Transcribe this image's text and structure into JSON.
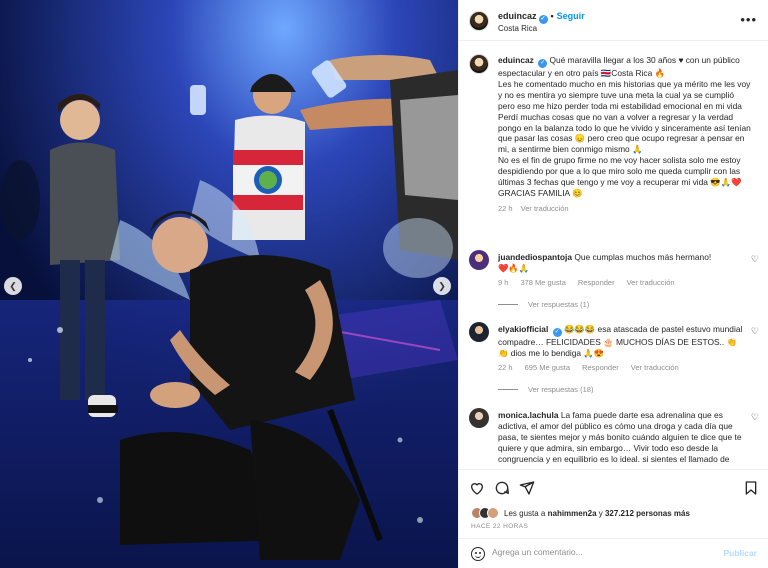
{
  "post": {
    "username": "eduincaz",
    "follow_label": "Seguir",
    "location": "Costa Rica",
    "more_label": "•••"
  },
  "caption": {
    "username": "eduincaz",
    "text": "Qué maravilla llegar a los 30 años ♥ con un público espectacular y en otro país 🇨🇷Costa Rica 🔥\nLes he comentado mucho en mis historias que ya mérito me les voy y no es mentira yo siempre tuve una meta la cual ya se cumplió pero eso me hizo perder toda mi estabilidad emocional en mi vida\nPerdí muchas cosas que no van a volver a regresar y la verdad pongo en la balanza todo lo que he vivido y sinceramente así tenían que pasar las cosas 😞 pero creo que ocupo regresar a pensar en mi, a sentirme bien conmigo mismo 🙏\nNo es el fin de grupo firme no me voy hacer solista solo me estoy despidiendo por que a lo que miro solo me queda cumplir con las últimas 3 fechas que tengo y me voy a recuperar mi vida 😎🙏❤️\nGRACIAS FAMILIA 😊",
    "time": "22 h",
    "translate": "Ver traducción"
  },
  "comments": [
    {
      "username": "juandediospantoja",
      "text": "Que cumplas muchos más hermano!\n❤️🔥🙏",
      "time": "9 h",
      "likes": "378 Me gusta",
      "reply": "Responder",
      "translate": "Ver traducción",
      "replies": "Ver respuestas (1)"
    },
    {
      "username": "elyakiofficial",
      "text": "😂😂😂 esa atascada de pastel estuvo mundial compadre… FELICIDADES 🎂 MUCHOS DÍAS DE ESTOS.. 👏👏 dios me lo bendiga 🙏😍",
      "time": "22 h",
      "likes": "695 Me gusta",
      "reply": "Responder",
      "translate": "Ver traducción",
      "replies": "Ver respuestas (18)"
    },
    {
      "username": "monica.lachula",
      "text": "La fama puede darte esa adrenalina que es adictiva, el amor del público es cómo una droga y cada día que pasa, te sientes mejor y más bonito cuándo alguien te dice que te quiere y que admira, sin embargo… Vivir todo eso desde la congruencia y en equilibrio es lo ideal. si sientes el llamado de"
    }
  ],
  "likes": {
    "prefix": "Les gusta a",
    "user": "nahimmen2a",
    "connector": "y",
    "count": "327.212 personas más"
  },
  "time_ago": "HACE 22 HORAS",
  "add_comment": {
    "placeholder": "Agrega un comentario...",
    "post_label": "Publicar"
  }
}
